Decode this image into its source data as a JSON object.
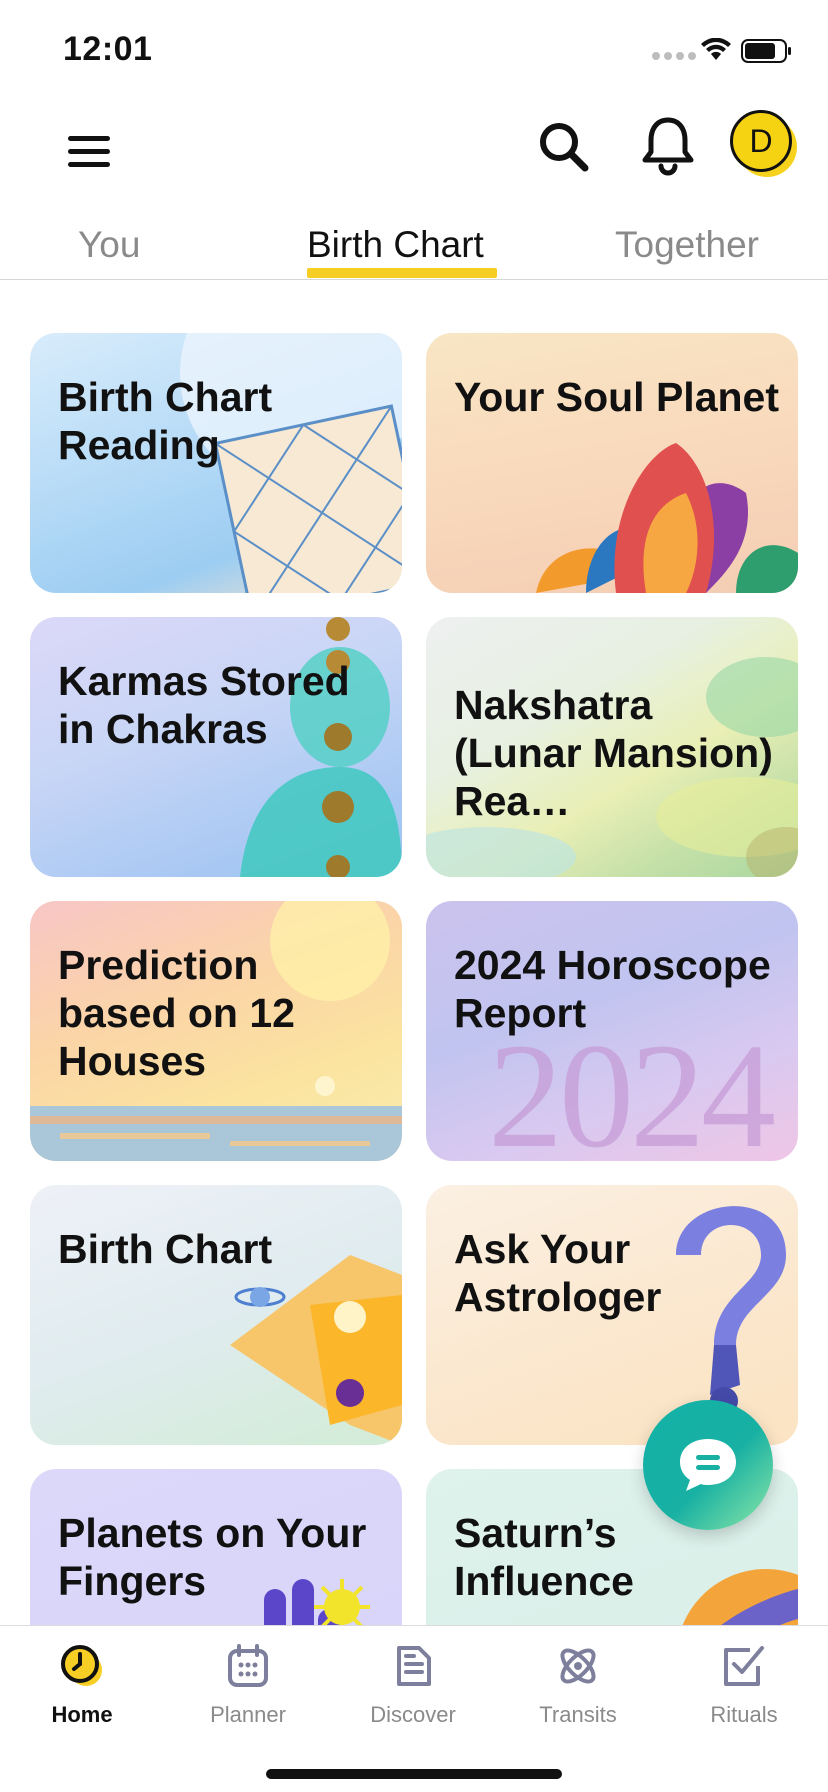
{
  "status_bar": {
    "time": "12:01"
  },
  "header": {
    "avatar_initial": "D"
  },
  "tabs": [
    {
      "label": "You",
      "active": false
    },
    {
      "label": "Birth Chart",
      "active": true
    },
    {
      "label": "Together",
      "active": false
    }
  ],
  "cards": [
    {
      "title": "Birth Chart Reading"
    },
    {
      "title": "Your Soul Planet"
    },
    {
      "title": "Karmas Stored in Chakras"
    },
    {
      "title": "Nakshatra (Lunar Mansion) Rea…"
    },
    {
      "title": "Prediction based on 12 Houses"
    },
    {
      "title": "2024 Horoscope Report",
      "art_text": "2024"
    },
    {
      "title": "Birth Chart"
    },
    {
      "title": "Ask Your Astrologer"
    },
    {
      "title": "Planets on Your Fingers"
    },
    {
      "title": "Saturn’s Influence"
    }
  ],
  "bottom_nav": [
    {
      "label": "Home",
      "icon": "home-clock-icon",
      "active": true
    },
    {
      "label": "Planner",
      "icon": "calendar-icon",
      "active": false
    },
    {
      "label": "Discover",
      "icon": "document-icon",
      "active": false
    },
    {
      "label": "Transits",
      "icon": "atom-icon",
      "active": false
    },
    {
      "label": "Rituals",
      "icon": "checkbox-icon",
      "active": false
    }
  ],
  "colors": {
    "accent": "#f7ce23",
    "fab": "#17b0a3",
    "text": "#111111",
    "muted": "#8a8a8a"
  }
}
